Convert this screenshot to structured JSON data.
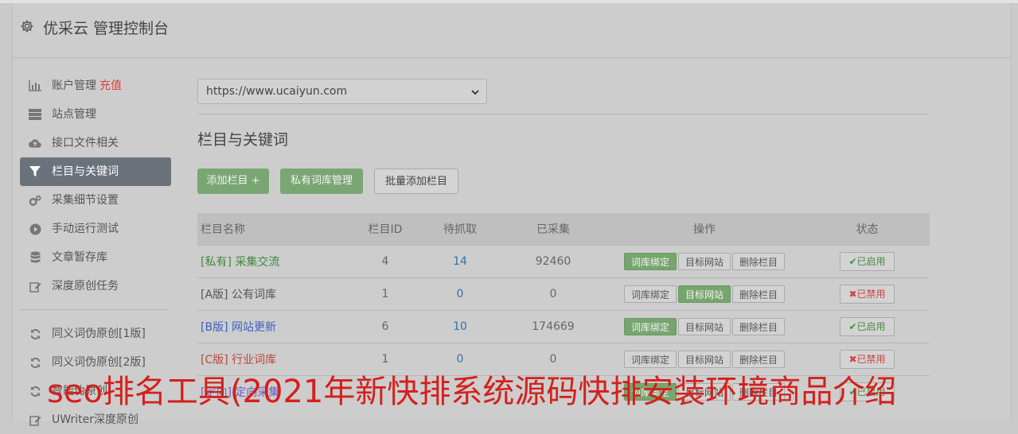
{
  "header": {
    "title": "优采云 管理控制台",
    "icon": "gear-icon"
  },
  "sidebar": {
    "items": [
      {
        "label": "账户管理",
        "extra": "充值",
        "icon": "bar-chart-icon"
      },
      {
        "label": "站点管理",
        "icon": "server-icon"
      },
      {
        "label": "接口文件相关",
        "icon": "cloud-upload-icon"
      },
      {
        "label": "栏目与关键词",
        "icon": "filter-icon",
        "active": true
      },
      {
        "label": "采集细节设置",
        "icon": "cogs-icon"
      },
      {
        "label": "手动运行测试",
        "icon": "play-circle-icon"
      },
      {
        "label": "文章暂存库",
        "icon": "database-icon"
      },
      {
        "label": "深度原创任务",
        "icon": "edit-icon"
      }
    ],
    "items2": [
      {
        "label": "同义词伪原创[1版]",
        "icon": "refresh-icon"
      },
      {
        "label": "同义词伪原创[2版]",
        "icon": "refresh-icon"
      },
      {
        "label": "智能伪原创",
        "icon": "refresh-icon"
      },
      {
        "label": "UWriter深度原创",
        "icon": "edit-icon"
      }
    ]
  },
  "site_select": {
    "value": "https://www.ucaiyun.com"
  },
  "section": {
    "title": "栏目与关键词"
  },
  "toolbar": {
    "add_label": "添加栏目 +",
    "private_label": "私有词库管理",
    "batch_label": "批量添加栏目"
  },
  "table": {
    "headers": [
      "栏目名称",
      "栏目ID",
      "待抓取",
      "已采集",
      "操作",
      "状态"
    ],
    "action_labels": {
      "bind": "词库绑定",
      "target": "目标网站",
      "delete": "删除栏目"
    },
    "rows": [
      {
        "name": "[私有] 采集交流",
        "id": "4",
        "pending": "14",
        "collected": "92460",
        "status": "已启用"
      },
      {
        "name": "[A版] 公有词库",
        "id": "1",
        "pending": "0",
        "collected": "0",
        "status": "已禁用"
      },
      {
        "name": "[B版] 网站更新",
        "id": "6",
        "pending": "10",
        "collected": "174669",
        "status": "已启用"
      },
      {
        "name": "[C版] 行业词库",
        "id": "1",
        "pending": "0",
        "collected": "0",
        "status": "已禁用"
      },
      {
        "name": "[定向] 定向采集",
        "id": "",
        "pending": "",
        "collected": "",
        "status": "已启用"
      }
    ]
  },
  "overlay_text": "seo排名工具(2021年新快排系统源码快排安装环境商品介绍",
  "colors": {
    "green": "#7aa674",
    "red": "#d9443b",
    "active_sidebar": "#6b727c"
  }
}
